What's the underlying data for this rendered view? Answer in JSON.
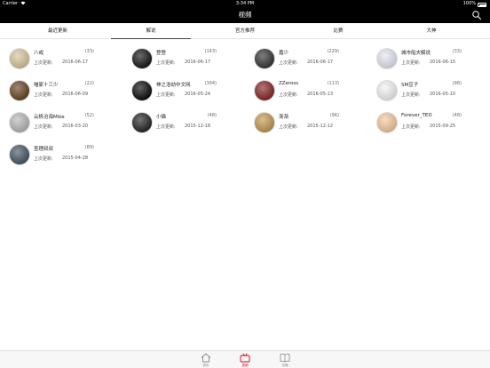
{
  "status": {
    "carrier": "Carrier",
    "time": "3:34 PM",
    "battery": "100%"
  },
  "header": {
    "title": "视频"
  },
  "tabs": [
    {
      "label": "最近更新",
      "active": false
    },
    {
      "label": "解说",
      "active": true
    },
    {
      "label": "官方推荐",
      "active": false
    },
    {
      "label": "比赛",
      "active": false
    },
    {
      "label": "大神",
      "active": false
    }
  ],
  "updated_label": "上次更新:",
  "items": [
    {
      "name": "八戒",
      "count": "(33)",
      "date": "2016-06-17",
      "avatar_color": "#d8c7a0"
    },
    {
      "name": "登登",
      "count": "(143)",
      "date": "2016-06-17",
      "avatar_color": "#1c1c1c"
    },
    {
      "name": "嘉少",
      "count": "(229)",
      "date": "2016-06-17",
      "avatar_color": "#3a3a3a"
    },
    {
      "name": "城市船夫解说",
      "count": "(33)",
      "date": "2016-06-15",
      "avatar_color": "#e6e6f2"
    },
    {
      "name": "喵家十三少",
      "count": "(22)",
      "date": "2016-06-09",
      "avatar_color": "#6b4a2a"
    },
    {
      "name": "神之浩劫中文网",
      "count": "(304)",
      "date": "2016-05-24",
      "avatar_color": "#111111"
    },
    {
      "name": "ZZeross",
      "count": "(113)",
      "date": "2016-05-13",
      "avatar_color": "#8a2b2b"
    },
    {
      "name": "SM豆子",
      "count": "(98)",
      "date": "2016-05-10",
      "avatar_color": "#f3f3f3"
    },
    {
      "name": "云帆沧海Mike",
      "count": "(52)",
      "date": "2016-03-20",
      "avatar_color": "#b9b9b9"
    },
    {
      "name": "小猫",
      "count": "(48)",
      "date": "2015-12-18",
      "avatar_color": "#2a2a2a"
    },
    {
      "name": "渐渐",
      "count": "(96)",
      "date": "2015-12-12",
      "avatar_color": "#c49a55"
    },
    {
      "name": "Forever_TED",
      "count": "(48)",
      "date": "2015-09-25",
      "avatar_color": "#f6c9a0"
    },
    {
      "name": "查理叔叔",
      "count": "(89)",
      "date": "2015-04-28",
      "avatar_color": "#4a5b6a"
    }
  ],
  "bottom_nav": [
    {
      "label": "首页",
      "icon": "home-icon",
      "active": false
    },
    {
      "label": "视频",
      "icon": "tv-icon",
      "active": true
    },
    {
      "label": "攻略",
      "icon": "book-icon",
      "active": false
    }
  ],
  "colors": {
    "accent": "#d0021b",
    "topbar": "#000000"
  }
}
